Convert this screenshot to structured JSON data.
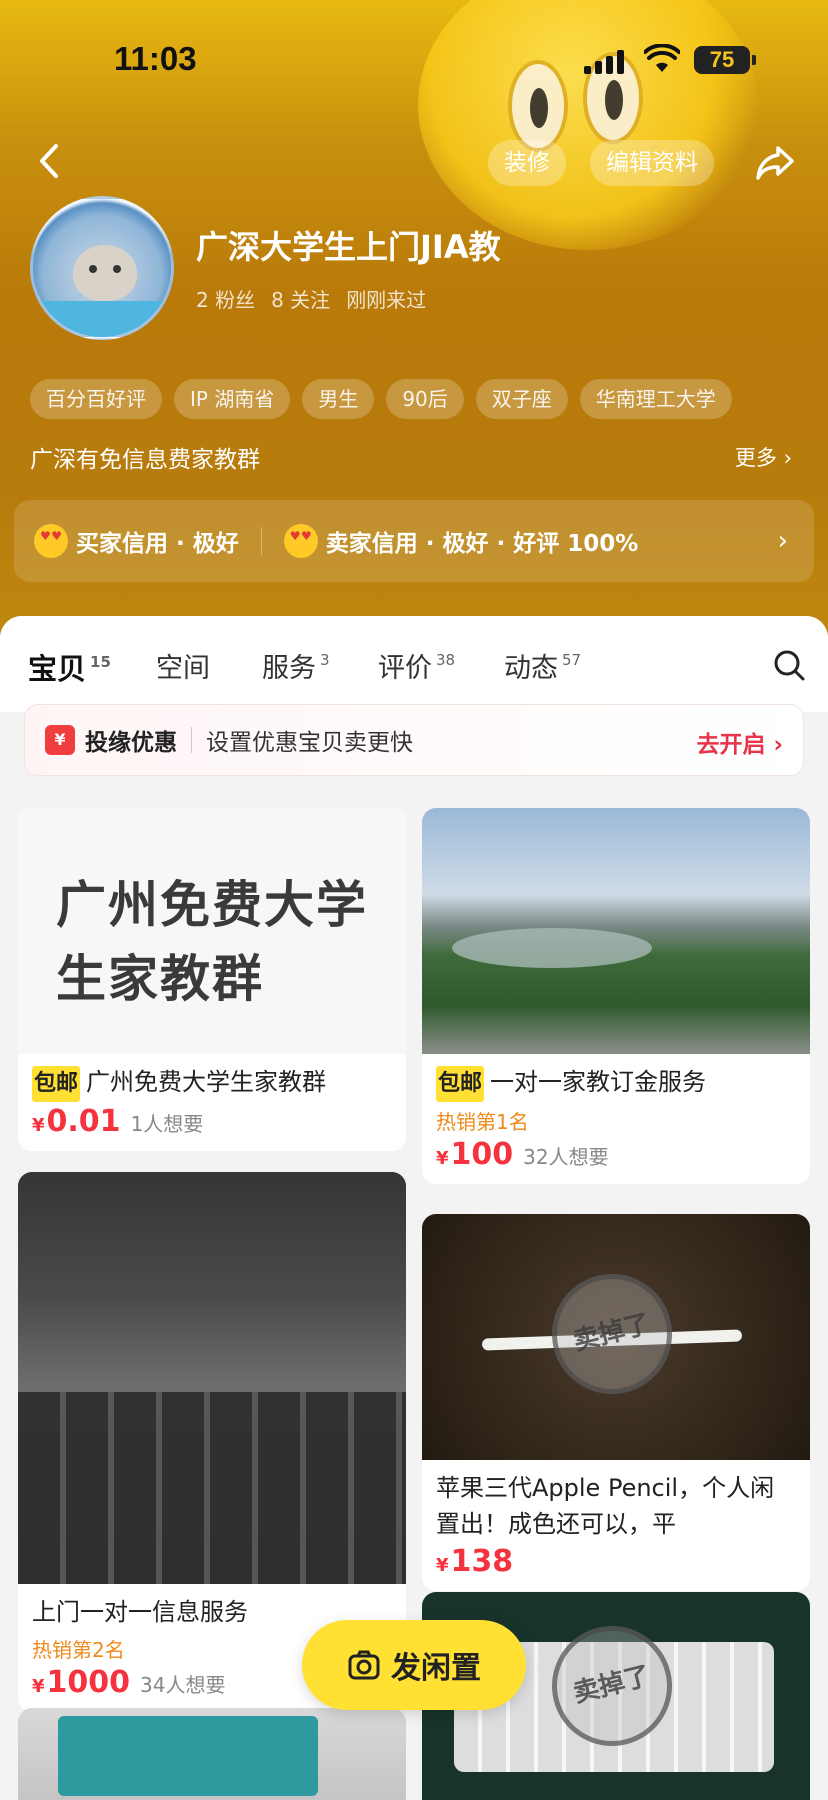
{
  "status_bar": {
    "time": "11:03",
    "battery": "75"
  },
  "header": {
    "decorate_label": "装修",
    "edit_label": "编辑资料",
    "nickname": "广深大学生上门JIA教",
    "stats": [
      "2 粉丝",
      "8 关注",
      "刚刚来过"
    ],
    "tags": [
      "百分百好评",
      "IP 湖南省",
      "男生",
      "90后",
      "双子座",
      "华南理工大学"
    ],
    "bio": "广深有免信息费家教群",
    "more_label": "更多 ›",
    "buyer_credit": "买家信用 · 极好",
    "seller_credit": "卖家信用 · 极好 · 好评 100%"
  },
  "tabs": [
    {
      "label": "宝贝",
      "count": "15"
    },
    {
      "label": "空间",
      "count": ""
    },
    {
      "label": "服务",
      "count": "3"
    },
    {
      "label": "评价",
      "count": "38"
    },
    {
      "label": "动态",
      "count": "57"
    }
  ],
  "promo": {
    "icon": "¥",
    "title": "投缘优惠",
    "desc": "设置优惠宝贝卖更快",
    "action": "去开启 ›"
  },
  "items": [
    {
      "image_text": "广州免费大学\n生家教群",
      "ship": "包邮",
      "title": "广州免费大学生家教群",
      "hot": "",
      "yen": "¥",
      "price": "0.01",
      "want": "1人想要"
    },
    {
      "ship": "包邮",
      "title": "一对一家教订金服务",
      "hot": "热销第1名",
      "yen": "¥",
      "price": "100",
      "want": "32人想要"
    },
    {
      "title": "上门一对一信息服务",
      "hot": "热销第2名",
      "yen": "¥",
      "price": "1000",
      "want": "34人想要"
    },
    {
      "title": "苹果三代Apple Pencil，个人闲置出！成色还可以，平",
      "yen": "¥",
      "price": "138",
      "want": "",
      "stamp": "卖掉了"
    },
    {
      "stamp": "卖掉了"
    }
  ],
  "fab": {
    "label": "发闲置"
  },
  "colors": {
    "accent_yellow": "#ffe033",
    "price_red": "#f5323d",
    "hot_orange": "#f08a1c"
  }
}
